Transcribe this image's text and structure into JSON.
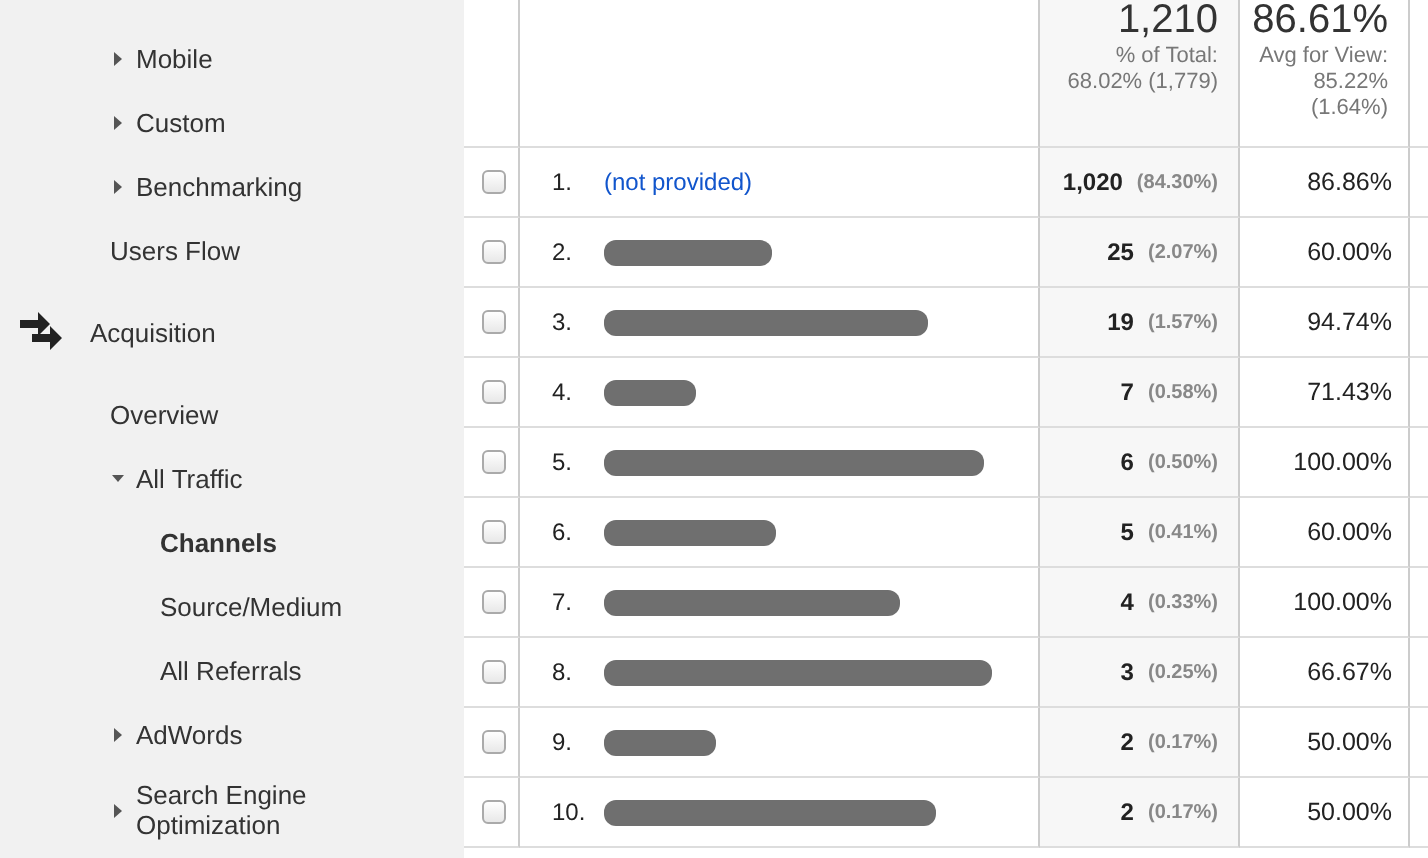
{
  "sidebar": {
    "items": [
      {
        "label": "Mobile",
        "expanded": false,
        "selected": false
      },
      {
        "label": "Custom",
        "expanded": false,
        "selected": false
      },
      {
        "label": "Benchmarking",
        "expanded": false,
        "selected": false
      },
      {
        "label": "Users Flow",
        "selected": false
      }
    ],
    "sections": [
      {
        "title": "Acquisition",
        "children": [
          {
            "label": "Overview",
            "selected": false
          },
          {
            "label": "All Traffic",
            "expanded": true,
            "selected": false,
            "children": [
              {
                "label": "Channels",
                "selected": true
              },
              {
                "label": "Source/Medium",
                "selected": false
              },
              {
                "label": "All Referrals",
                "selected": false
              }
            ]
          },
          {
            "label": "AdWords",
            "expanded": false,
            "selected": false
          },
          {
            "label": "Search Engine Optimization",
            "expanded": false,
            "selected": false
          }
        ]
      }
    ]
  },
  "table": {
    "summary": [
      {
        "total": "1,210",
        "caption": "% of Total: 68.02% (1,779)"
      },
      {
        "total": "86.61%",
        "caption": "Avg for View: 85.22% (1.64%)"
      }
    ],
    "rows": [
      {
        "index": "1.",
        "source": {
          "kind": "link",
          "text": "(not provided)"
        },
        "sessions": "1,020",
        "share": "(84.30%)",
        "rate": "86.86%",
        "checked": false
      },
      {
        "index": "2.",
        "source": {
          "kind": "redacted"
        },
        "sessions": "25",
        "share": "(2.07%)",
        "rate": "60.00%",
        "checked": false
      },
      {
        "index": "3.",
        "source": {
          "kind": "redacted"
        },
        "sessions": "19",
        "share": "(1.57%)",
        "rate": "94.74%",
        "checked": false
      },
      {
        "index": "4.",
        "source": {
          "kind": "redacted"
        },
        "sessions": "7",
        "share": "(0.58%)",
        "rate": "71.43%",
        "checked": false
      },
      {
        "index": "5.",
        "source": {
          "kind": "redacted"
        },
        "sessions": "6",
        "share": "(0.50%)",
        "rate": "100.00%",
        "checked": false
      },
      {
        "index": "6.",
        "source": {
          "kind": "redacted"
        },
        "sessions": "5",
        "share": "(0.41%)",
        "rate": "60.00%",
        "checked": false
      },
      {
        "index": "7.",
        "source": {
          "kind": "redacted"
        },
        "sessions": "4",
        "share": "(0.33%)",
        "rate": "100.00%",
        "checked": false
      },
      {
        "index": "8.",
        "source": {
          "kind": "redacted"
        },
        "sessions": "3",
        "share": "(0.25%)",
        "rate": "66.67%",
        "checked": false
      },
      {
        "index": "9.",
        "source": {
          "kind": "redacted"
        },
        "sessions": "2",
        "share": "(0.17%)",
        "rate": "50.00%",
        "checked": false
      },
      {
        "index": "10.",
        "source": {
          "kind": "redacted"
        },
        "sessions": "2",
        "share": "(0.17%)",
        "rate": "50.00%",
        "checked": false
      }
    ]
  }
}
